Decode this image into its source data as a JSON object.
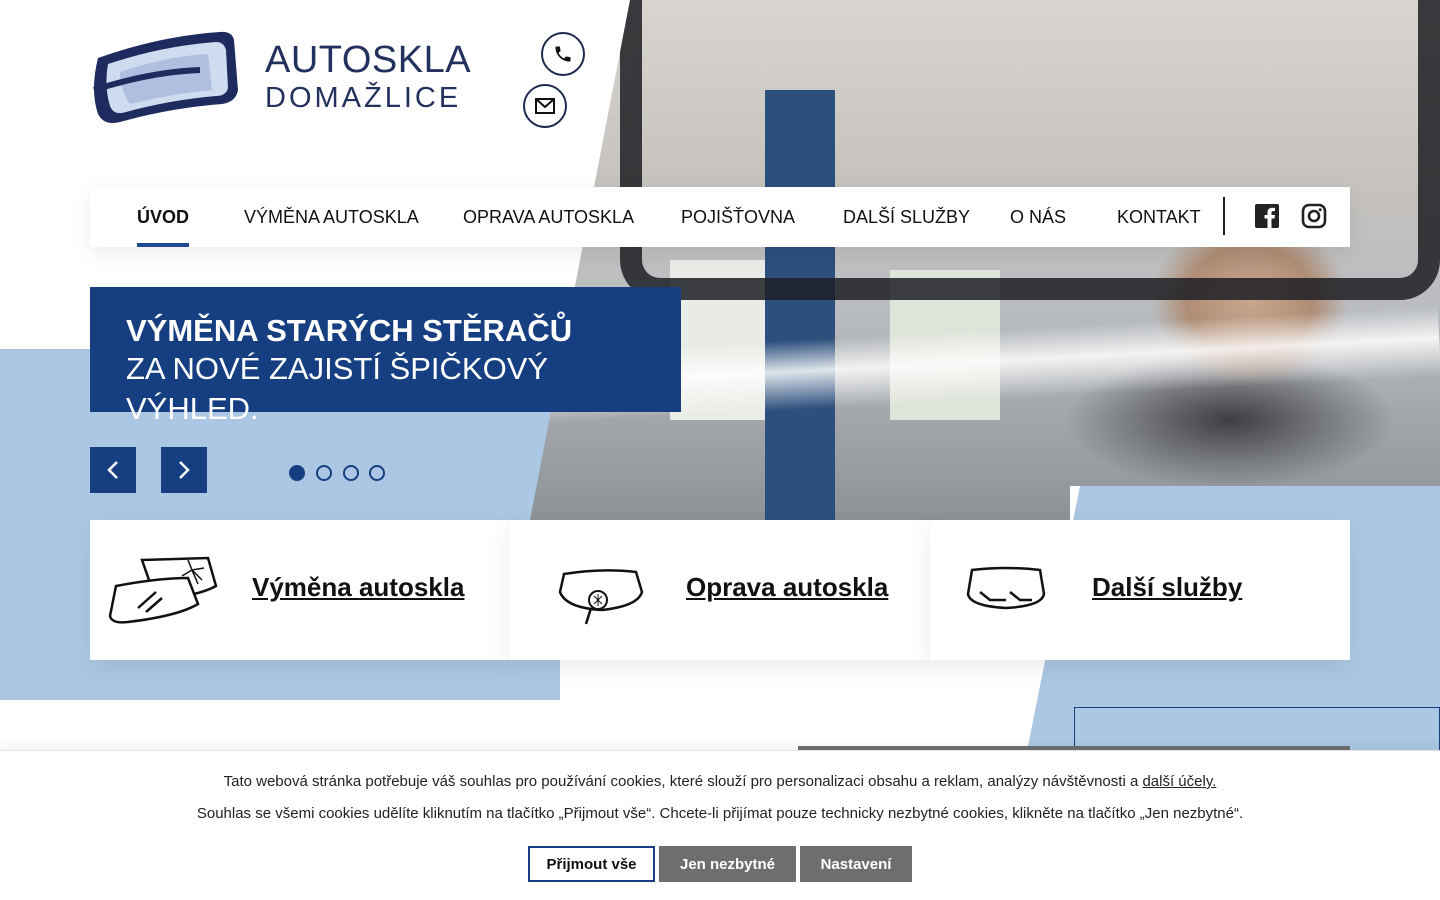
{
  "brand": {
    "line1": "AUTOSKLA",
    "line2": "DOMAŽLICE"
  },
  "contacts": {
    "phone_icon": "phone-icon",
    "mail_icon": "mail-icon"
  },
  "nav": {
    "items": [
      {
        "label": "ÚVOD",
        "active": true
      },
      {
        "label": "VÝMĚNA AUTOSKLA",
        "active": false
      },
      {
        "label": "OPRAVA AUTOSKLA",
        "active": false
      },
      {
        "label": "POJIŠŤOVNA",
        "active": false
      },
      {
        "label": "DALŠÍ SLUŽBY",
        "active": false
      },
      {
        "label": "O NÁS",
        "active": false
      },
      {
        "label": "KONTAKT",
        "active": false
      }
    ],
    "social": [
      "facebook-icon",
      "instagram-icon"
    ]
  },
  "slider": {
    "caption_bold": "VÝMĚNA STARÝCH STĚRAČŮ",
    "caption_regular": "ZA NOVÉ ZAJISTÍ ŠPIČKOVÝ VÝHLED.",
    "dots": 4,
    "active_dot": 1
  },
  "services": [
    {
      "label": "Výměna autoskla",
      "icon": "broken-windshield-icon"
    },
    {
      "label": "Oprava autoskla",
      "icon": "windshield-repair-icon"
    },
    {
      "label": "Další služby",
      "icon": "wipers-icon"
    }
  ],
  "cookie": {
    "text1": "Tato webová stránka potřebuje váš souhlas pro používání cookies, které slouží pro personalizaci obsahu a reklam, analýzy návštěvnosti a",
    "link": "další účely.",
    "text2": "Souhlas se všemi cookies udělíte kliknutím na tlačítko „Přijmout vše“. Chcete-li přijímat pouze technicky nezbytné cookies, klikněte na tlačítko „Jen nezbytné“.",
    "accept": "Přijmout vše",
    "necessary": "Jen nezbytné",
    "settings": "Nastavení"
  },
  "colors": {
    "primary": "#163f82",
    "light_blue": "#abc7e3",
    "logo_navy": "#23315e",
    "button_grey": "#6e6e6e"
  }
}
